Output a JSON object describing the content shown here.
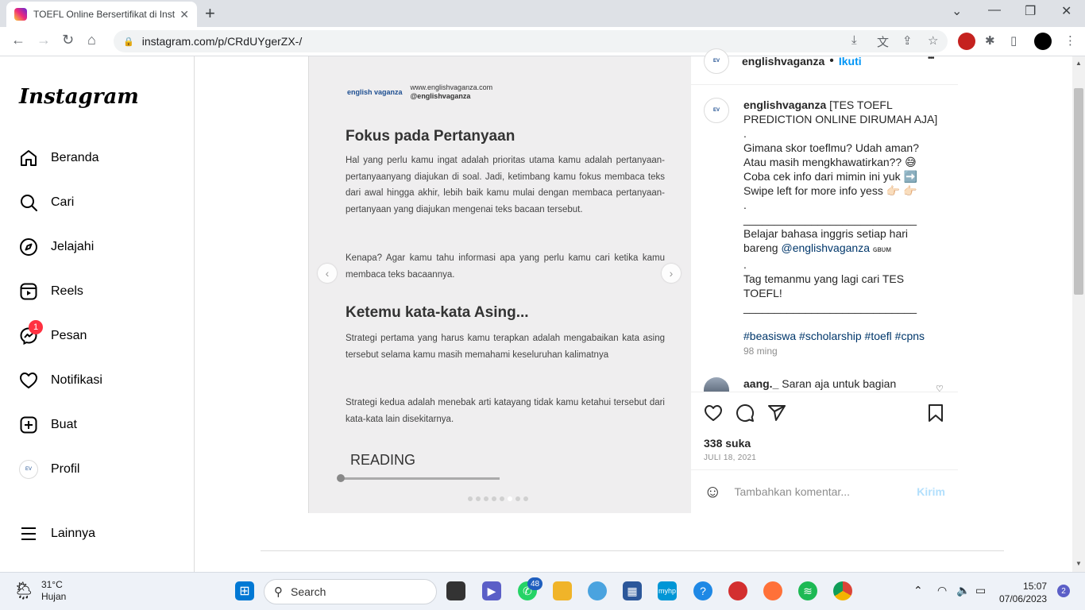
{
  "browser": {
    "tab_title": "TOEFL Online Bersertifikat di Insta",
    "tab_close": "✕",
    "new_tab": "+",
    "url": "instagram.com/p/CRdUYgerZX-/",
    "window_controls": {
      "minimize": "—",
      "restore": "❐",
      "close": "✕",
      "dropdown": "⌄"
    }
  },
  "sidebar": {
    "logo": "Instagram",
    "items": [
      {
        "label": "Beranda",
        "icon": "home-icon"
      },
      {
        "label": "Cari",
        "icon": "search-icon"
      },
      {
        "label": "Jelajahi",
        "icon": "compass-icon"
      },
      {
        "label": "Reels",
        "icon": "reels-icon"
      },
      {
        "label": "Pesan",
        "icon": "messenger-icon",
        "badge": "1"
      },
      {
        "label": "Notifikasi",
        "icon": "heart-icon"
      },
      {
        "label": "Buat",
        "icon": "plus-square-icon"
      },
      {
        "label": "Profil",
        "icon": "profile-avatar"
      }
    ],
    "more": "Lainnya"
  },
  "post": {
    "slide": {
      "brand_logo": "english vaganza",
      "brand_site": "www.englishvaganza.com",
      "brand_handle": "@englishvaganza",
      "heading1": "Fokus pada Pertanyaan",
      "para1": "Hal yang perlu kamu ingat adalah prioritas utama kamu adalah pertanyaan-pertanyaanyang diajukan di soal. Jadi, ketimbang kamu fokus membaca teks dari awal hingga akhir, lebih baik kamu mulai dengan membaca pertanyaan-pertanyaan yang diajukan mengenai teks bacaan tersebut.",
      "para2": "Kenapa? Agar kamu tahu informasi apa yang perlu kamu cari ketika kamu membaca teks bacaannya.",
      "heading2": "Ketemu kata-kata Asing...",
      "para3": "Strategi pertama yang harus kamu terapkan adalah mengabaikan kata asing tersebut selama kamu masih memahami keseluruhan kalimatnya",
      "para4": "Strategi kedua adalah menebak arti katayang tidak kamu ketahui tersebut dari kata-kata lain disekitarnya.",
      "reading_label": "READING",
      "prev": "‹",
      "next": "›",
      "slide_count": 8,
      "active_slide": 6
    },
    "header": {
      "username": "englishvaganza",
      "separator": "•",
      "follow": "Ikuti",
      "more": "•••"
    },
    "caption": {
      "username": "englishvaganza",
      "lines": [
        "[TES TOEFL PREDICTION ONLINE DIRUMAH AJA]",
        ".",
        "Gimana skor toeflmu? Udah aman?",
        "Atau masih mengkhawatirkan?? 😅",
        "Coba cek info dari mimin ini yuk ➡️",
        "Swipe left for more info yess 👉🏻 👉🏻",
        ".",
        "____________________________",
        "Belajar bahasa inggris setiap hari",
        "bareng",
        ".",
        "Tag temanmu yang lagi cari TES",
        "TOEFL!",
        "____________________________"
      ],
      "mention": "@englishvaganza",
      "mention_suffix": "ɢʙᴜᴍ",
      "hashtags": "#beasiswa #scholarship #toefl #cpns",
      "time": "98 ming"
    },
    "comment": {
      "username": "aang._",
      "text": "Saran aja untuk bagian"
    },
    "likes": "338 suka",
    "date": "JULI 18, 2021",
    "add_comment_placeholder": "Tambahkan komentar...",
    "send": "Kirim"
  },
  "taskbar": {
    "temp": "31°C",
    "condition": "Hujan",
    "search": "Search",
    "whatsapp_badge": "48",
    "time": "15:07",
    "date": "07/06/2023",
    "notifications": "2"
  }
}
